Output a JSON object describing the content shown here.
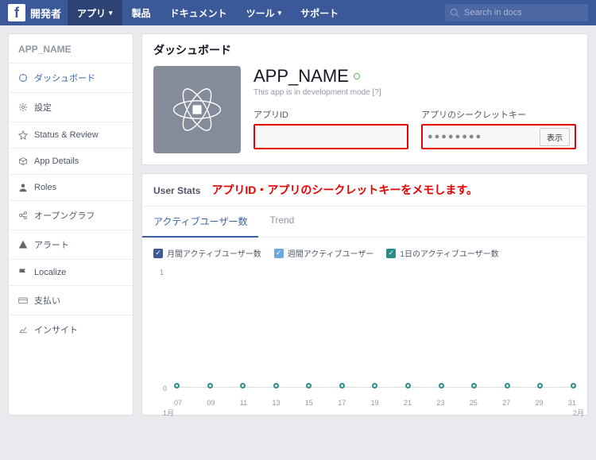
{
  "nav": {
    "brand": "開発者",
    "links": [
      {
        "label": "アプリ",
        "dropdown": true,
        "active": true
      },
      {
        "label": "製品",
        "dropdown": false
      },
      {
        "label": "ドキュメント",
        "dropdown": false
      },
      {
        "label": "ツール",
        "dropdown": true
      },
      {
        "label": "サポート",
        "dropdown": false
      }
    ],
    "search_placeholder": "Search in docs"
  },
  "sidebar": {
    "title": "APP_NAME",
    "items": [
      {
        "label": "ダッシュボード",
        "active": true
      },
      {
        "label": "設定"
      },
      {
        "label": "Status & Review"
      },
      {
        "label": "App Details"
      },
      {
        "label": "Roles"
      },
      {
        "label": "オープングラフ"
      },
      {
        "label": "アラート"
      },
      {
        "label": "Localize"
      },
      {
        "label": "支払い"
      },
      {
        "label": "インサイト"
      }
    ]
  },
  "dash": {
    "heading": "ダッシュボード",
    "app_name": "APP_NAME",
    "dev_note": "This app is in development mode [?]",
    "app_id_label": "アプリID",
    "app_id_value": "",
    "secret_label": "アプリのシークレットキー",
    "secret_value": "●●●●●●●●",
    "show_btn": "表示"
  },
  "stats": {
    "title": "User Stats",
    "annotation": "アプリID・アプリのシークレットキーをメモします。",
    "tabs": [
      {
        "label": "アクティブユーザー数",
        "active": true
      },
      {
        "label": "Trend"
      }
    ],
    "legend": [
      {
        "label": "月間アクティブユーザー数",
        "color": "blue"
      },
      {
        "label": "週間アクティブユーザー",
        "color": "lblue"
      },
      {
        "label": "1日のアクティブユーザー数",
        "color": "teal"
      }
    ]
  },
  "chart_data": {
    "type": "line",
    "xlabel": "",
    "ylabel": "",
    "ylim": [
      0,
      1
    ],
    "y_ticks": [
      "1",
      "0"
    ],
    "x_ticks": [
      "07",
      "09",
      "11",
      "13",
      "15",
      "17",
      "19",
      "21",
      "23",
      "25",
      "27",
      "29",
      "31"
    ],
    "month_start": "1月",
    "month_end": "2月",
    "series": [
      {
        "name": "月間アクティブユーザー数",
        "values": [
          0,
          0,
          0,
          0,
          0,
          0,
          0,
          0,
          0,
          0,
          0,
          0,
          0
        ]
      },
      {
        "name": "週間アクティブユーザー",
        "values": [
          0,
          0,
          0,
          0,
          0,
          0,
          0,
          0,
          0,
          0,
          0,
          0,
          0
        ]
      },
      {
        "name": "1日のアクティブユーザー数",
        "values": [
          0,
          0,
          0,
          0,
          0,
          0,
          0,
          0,
          0,
          0,
          0,
          0,
          0
        ]
      }
    ]
  }
}
